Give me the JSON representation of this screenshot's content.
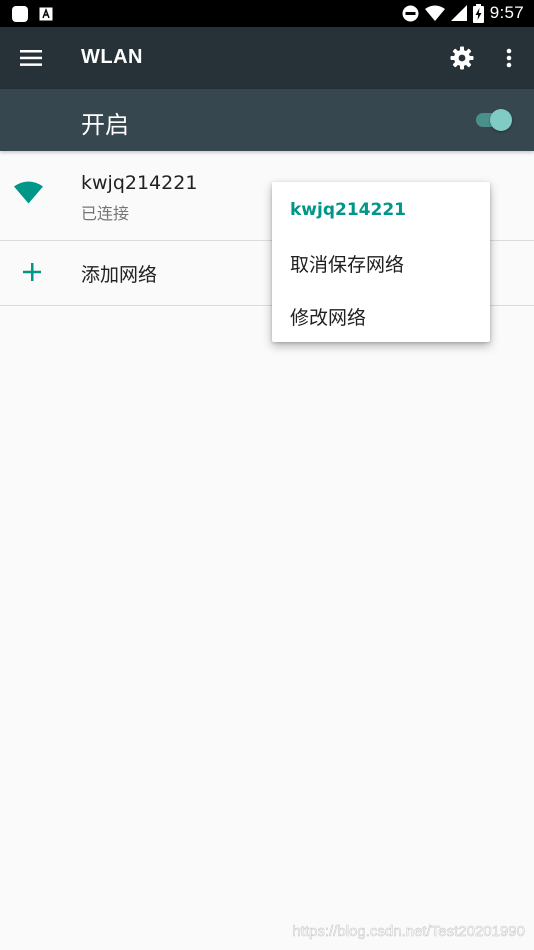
{
  "status_bar": {
    "time": "9:57",
    "icons": [
      "app-icon",
      "font-icon",
      "do-not-disturb-icon",
      "wifi-signal-icon",
      "cell-signal-icon",
      "battery-charging-icon"
    ]
  },
  "app_bar": {
    "title": "WLAN",
    "icons": [
      "menu-icon",
      "gear-icon",
      "overflow-icon"
    ]
  },
  "wifi_switch": {
    "label": "开启",
    "checked": true
  },
  "network": {
    "name": "kwjq214221",
    "status": "已连接"
  },
  "add_network": {
    "label": "添加网络"
  },
  "context_menu": {
    "title": "kwjq214221",
    "items": [
      "取消保存网络",
      "修改网络"
    ]
  },
  "colors": {
    "accent": "#009688",
    "app_bar": "#263238",
    "switch_bar": "#37474f",
    "background": "#fafafa"
  },
  "watermark": "https://blog.csdn.net/Test20201990"
}
